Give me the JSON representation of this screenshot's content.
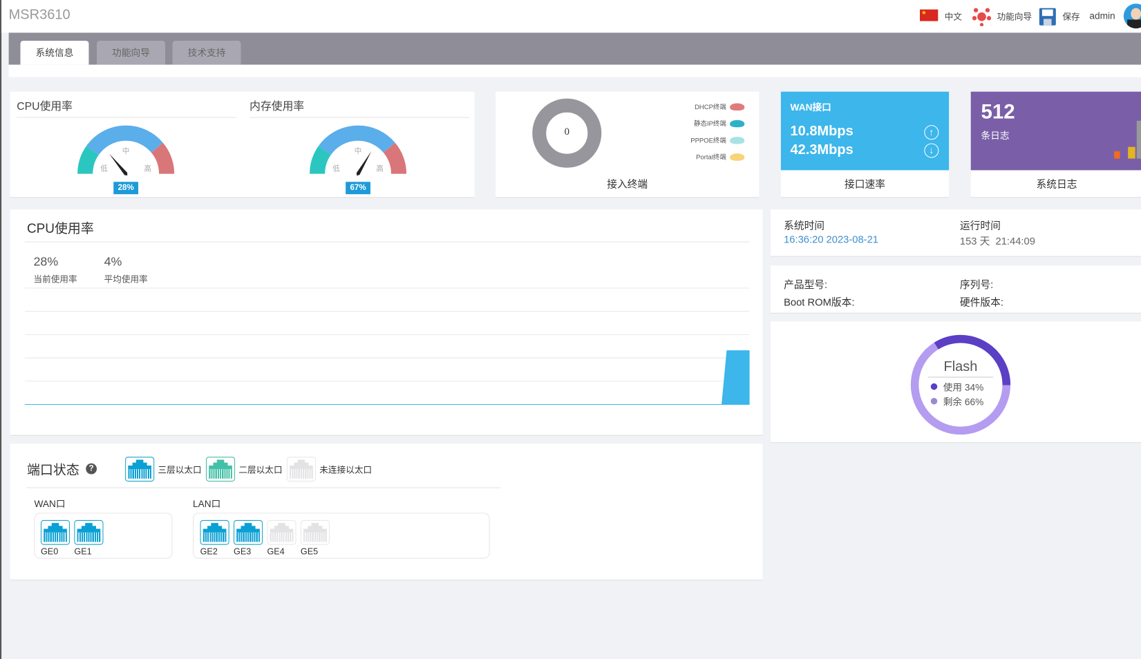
{
  "header": {
    "title": "MSR3610",
    "language": "中文",
    "wizard": "功能向导",
    "save": "保存",
    "user": "admin"
  },
  "tabs": [
    {
      "label": "系统信息",
      "active": true
    },
    {
      "label": "功能向导"
    },
    {
      "label": "技术支持"
    }
  ],
  "gauges": [
    {
      "title": "CPU使用率",
      "value": 28,
      "label": "28%",
      "low": "低",
      "mid": "中",
      "high": "高"
    },
    {
      "title": "内存使用率",
      "value": 67,
      "label": "67%",
      "low": "低",
      "mid": "中",
      "high": "高"
    }
  ],
  "terminals": {
    "count": "0",
    "caption": "接入终端",
    "legend": [
      {
        "label": "DHCP终端",
        "color": "#e07b7b"
      },
      {
        "label": "静态IP终端",
        "color": "#2eb1c8"
      },
      {
        "label": "PPPOE终端",
        "color": "#a8e3e3"
      },
      {
        "label": "Portal终端",
        "color": "#f7d37a"
      }
    ]
  },
  "wan": {
    "title": "WAN接口",
    "up": "10.8Mbps",
    "down": "42.3Mbps",
    "caption": "接口速率",
    "color": "#3cb6eb"
  },
  "log": {
    "count": "512",
    "unit": "条日志",
    "caption": "系统日志",
    "color": "#7a5fa8"
  },
  "cpu_chart": {
    "title": "CPU使用率",
    "current": "28%",
    "current_label": "当前使用率",
    "avg": "4%",
    "avg_label": "平均使用率"
  },
  "chart_data": {
    "type": "area",
    "values": [
      0,
      0,
      0,
      0,
      0,
      0,
      0,
      0,
      0,
      0,
      0,
      0,
      0,
      0,
      0,
      0,
      0,
      0,
      0,
      0,
      0,
      0,
      0,
      0,
      0,
      0,
      0,
      28,
      28
    ],
    "ylim": [
      0,
      100
    ],
    "grid": true,
    "color": "#3cb6eb"
  },
  "ports": {
    "title": "端口状态",
    "legend": [
      "三层以太口",
      "二层以太口",
      "未连接以太口"
    ],
    "wan_label": "WAN口",
    "lan_label": "LAN口",
    "wan": [
      {
        "name": "GE0",
        "state": "l3"
      },
      {
        "name": "GE1",
        "state": "l3"
      }
    ],
    "lan": [
      {
        "name": "GE2",
        "state": "l3"
      },
      {
        "name": "GE3",
        "state": "l3"
      },
      {
        "name": "GE4",
        "state": "down"
      },
      {
        "name": "GE5",
        "state": "down"
      }
    ]
  },
  "system": {
    "time_label": "系统时间",
    "time": "16:36:20 2023-08-21",
    "uptime_label": "运行时间",
    "uptime": "153 天  21:44:09",
    "model_label": "产品型号:",
    "serial_label": "序列号:",
    "bootrom_label": "Boot ROM版本:",
    "hw_label": "硬件版本:"
  },
  "flash": {
    "title": "Flash",
    "used_label": "使用 34%",
    "free_label": "剩余 66%",
    "used": 34,
    "free": 66,
    "used_color": "#5b3fc4",
    "free_color": "#b49cf0"
  }
}
